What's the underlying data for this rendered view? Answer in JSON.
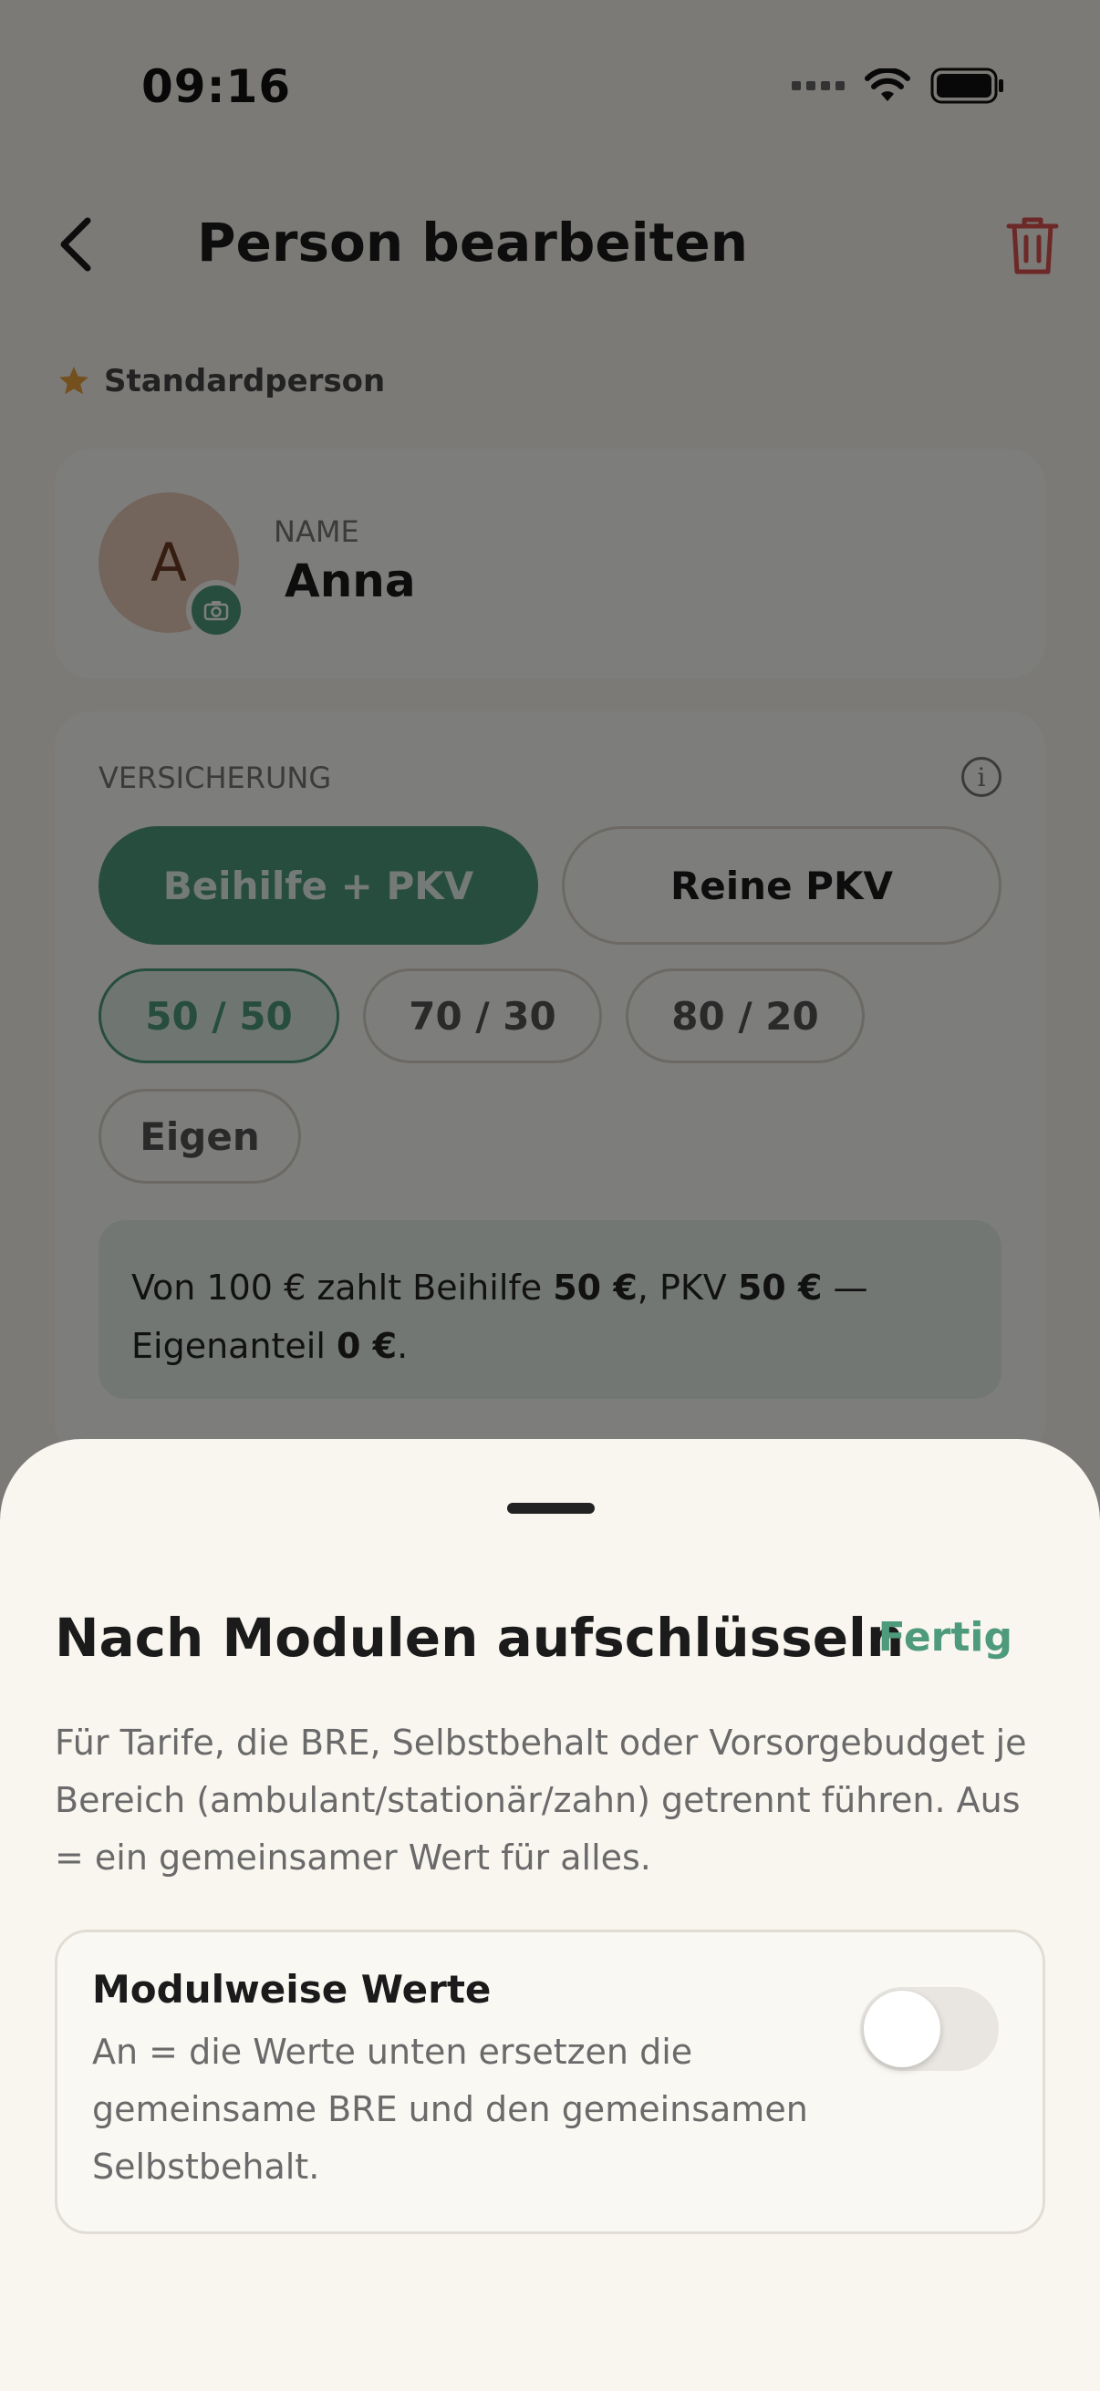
{
  "status": {
    "time": "09:16"
  },
  "header": {
    "title": "Person bearbeiten"
  },
  "person": {
    "standard_label": "Standardperson",
    "avatar_initial": "A",
    "name_label": "NAME",
    "name_value": "Anna"
  },
  "insurance": {
    "label": "VERSICHERUNG",
    "info_glyph": "i",
    "types": [
      "Beihilfe + PKV",
      "Reine PKV"
    ],
    "selected_type": "Beihilfe + PKV",
    "splits": [
      "50 / 50",
      "70 / 30",
      "80 / 20",
      "Eigen"
    ],
    "selected_split": "50 / 50",
    "summary": {
      "part1": "Von 100 € zahlt Beihilfe ",
      "beihilfe": "50 €",
      "part2": ", PKV ",
      "pkv": "50 €",
      "part3": " — Eigenanteil ",
      "eigen": "0 €",
      "part4": "."
    }
  },
  "sheet": {
    "title": "Nach Modulen aufschlüsseln",
    "done": "Fertig",
    "description": "Für Tarife, die BRE, Selbstbehalt oder Vorsorgebudget je Bereich (ambulant/stationär/zahn) getrennt führen. Aus = ein gemeinsamer Wert für alles.",
    "option": {
      "title": "Modulweise Werte",
      "description": "An = die Werte unten ersetzen die gemeinsame BRE und den gemeinsamen Selbstbehalt.",
      "enabled": false
    }
  },
  "colors": {
    "accent": "#4e9a7c",
    "danger": "#d9534f",
    "background": "#f7f4ee"
  }
}
